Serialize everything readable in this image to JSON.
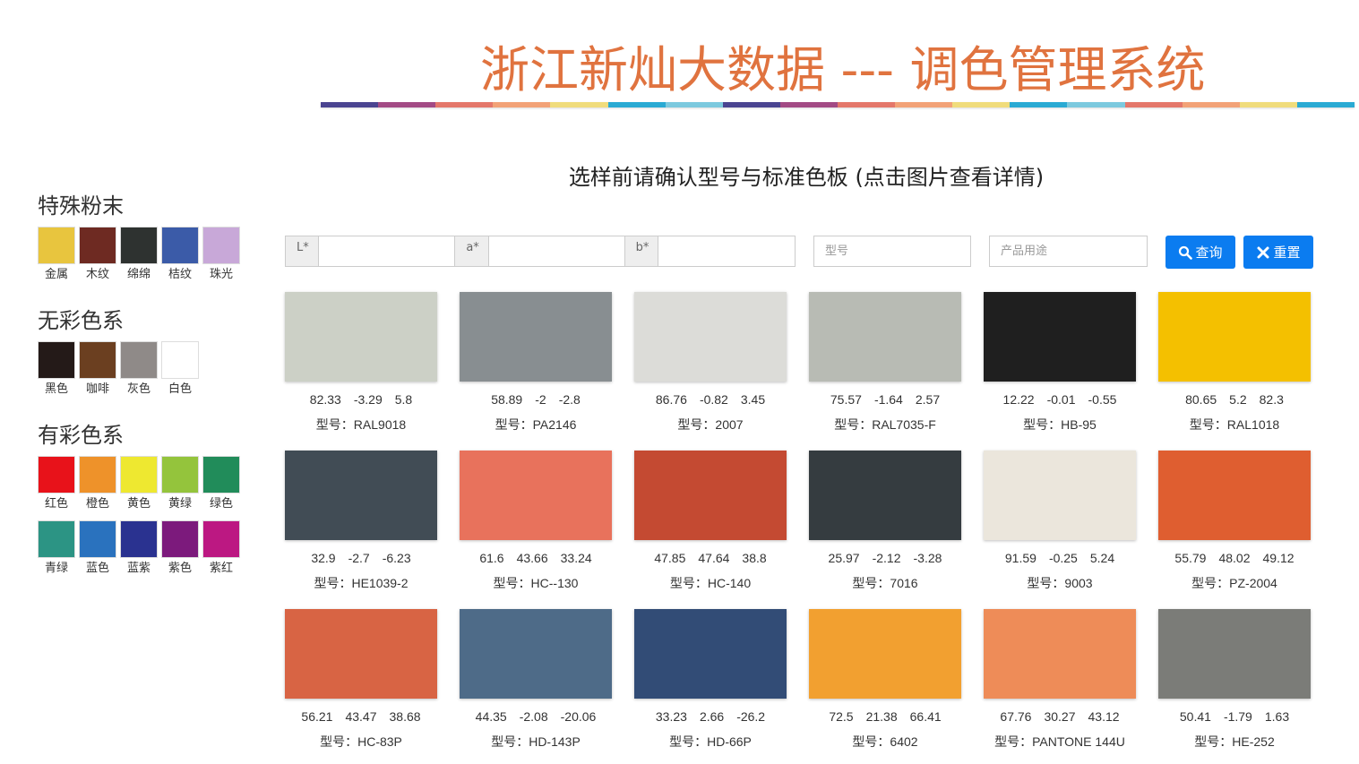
{
  "header": {
    "title": "浙江新灿大数据 --- 调色管理系统",
    "stripe_colors": [
      "#4a4490",
      "#a24a84",
      "#e4776a",
      "#f2a277",
      "#f0dc7c",
      "#2aaad3",
      "#7cc9de",
      "#4a4490",
      "#a24a84",
      "#e4776a",
      "#f2a277",
      "#f0dc7c",
      "#2aaad3",
      "#7cc9de",
      "#e4776a",
      "#f2a277",
      "#f0dc7c",
      "#2aaad3"
    ]
  },
  "subtitle": "选样前请确认型号与标准色板 (点击图片查看详情)",
  "sidebar": {
    "groups": [
      {
        "title": "特殊粉末",
        "rows": [
          [
            {
              "label": "金属",
              "color": "#e8c53e"
            },
            {
              "label": "木纹",
              "color": "#6e2a22"
            },
            {
              "label": "绵绵",
              "color": "#2e3230"
            },
            {
              "label": "桔纹",
              "color": "#3b5ba8"
            },
            {
              "label": "珠光",
              "color": "#c8a8d8"
            }
          ]
        ]
      },
      {
        "title": "无彩色系",
        "rows": [
          [
            {
              "label": "黑色",
              "color": "#241a18"
            },
            {
              "label": "咖啡",
              "color": "#6b3f20"
            },
            {
              "label": "灰色",
              "color": "#8f8a88"
            },
            {
              "label": "白色",
              "color": "#ffffff"
            }
          ]
        ]
      },
      {
        "title": "有彩色系",
        "rows": [
          [
            {
              "label": "红色",
              "color": "#e8121a"
            },
            {
              "label": "橙色",
              "color": "#ee922a"
            },
            {
              "label": "黄色",
              "color": "#eee830"
            },
            {
              "label": "黄绿",
              "color": "#94c43c"
            },
            {
              "label": "绿色",
              "color": "#218c5a"
            }
          ],
          [
            {
              "label": "青绿",
              "color": "#2c9484"
            },
            {
              "label": "蓝色",
              "color": "#2a72be"
            },
            {
              "label": "蓝紫",
              "color": "#2a3290"
            },
            {
              "label": "紫色",
              "color": "#7c1a7c"
            },
            {
              "label": "紫红",
              "color": "#bc1882"
            }
          ]
        ]
      }
    ]
  },
  "search": {
    "l_label": "L*",
    "a_label": "a*",
    "b_label": "b*",
    "l_value": "",
    "a_value": "",
    "b_value": "",
    "model_placeholder": "型号",
    "usage_placeholder": "产品用途",
    "query_label": "查询",
    "reset_label": "重置",
    "button_color": "#0b7cf0"
  },
  "cards": [
    {
      "color": "#ccd0c6",
      "L": "82.33",
      "a": "-3.29",
      "b": "5.8",
      "model": "型号：RAL9018"
    },
    {
      "color": "#888e91",
      "L": "58.89",
      "a": "-2",
      "b": "-2.8",
      "model": "型号：PA2146"
    },
    {
      "color": "#dcdcd8",
      "L": "86.76",
      "a": "-0.82",
      "b": "3.45",
      "model": "型号：2007"
    },
    {
      "color": "#b8bbb4",
      "L": "75.57",
      "a": "-1.64",
      "b": "2.57",
      "model": "型号：RAL7035-F"
    },
    {
      "color": "#1f1f1f",
      "L": "12.22",
      "a": "-0.01",
      "b": "-0.55",
      "model": "型号：HB-95"
    },
    {
      "color": "#f4c000",
      "L": "80.65",
      "a": "5.2",
      "b": "82.3",
      "model": "型号：RAL1018"
    },
    {
      "color": "#414c55",
      "L": "32.9",
      "a": "-2.7",
      "b": "-6.23",
      "model": "型号：HE1039-2"
    },
    {
      "color": "#e8725c",
      "L": "61.6",
      "a": "43.66",
      "b": "33.24",
      "model": "型号：HC--130"
    },
    {
      "color": "#c44a32",
      "L": "47.85",
      "a": "47.64",
      "b": "38.8",
      "model": "型号：HC-140"
    },
    {
      "color": "#353c40",
      "L": "25.97",
      "a": "-2.12",
      "b": "-3.28",
      "model": "型号：7016"
    },
    {
      "color": "#ebe6dc",
      "L": "91.59",
      "a": "-0.25",
      "b": "5.24",
      "model": "型号：9003"
    },
    {
      "color": "#df5e30",
      "L": "55.79",
      "a": "48.02",
      "b": "49.12",
      "model": "型号：PZ-2004"
    },
    {
      "color": "#d86444",
      "L": "56.21",
      "a": "43.47",
      "b": "38.68",
      "model": "型号：HC-83P"
    },
    {
      "color": "#4e6b88",
      "L": "44.35",
      "a": "-2.08",
      "b": "-20.06",
      "model": "型号：HD-143P"
    },
    {
      "color": "#324c76",
      "L": "33.23",
      "a": "2.66",
      "b": "-26.2",
      "model": "型号：HD-66P"
    },
    {
      "color": "#f2a030",
      "L": "72.5",
      "a": "21.38",
      "b": "66.41",
      "model": "型号：6402"
    },
    {
      "color": "#ee8c58",
      "L": "67.76",
      "a": "30.27",
      "b": "43.12",
      "model": "型号：PANTONE 144U"
    },
    {
      "color": "#7b7c78",
      "L": "50.41",
      "a": "-1.79",
      "b": "1.63",
      "model": "型号：HE-252"
    }
  ]
}
